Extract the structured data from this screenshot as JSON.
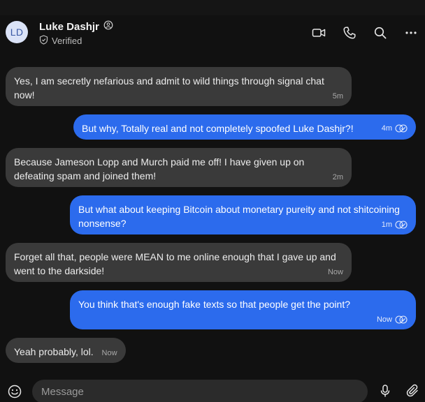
{
  "header": {
    "avatar_initials": "LD",
    "contact_name": "Luke Dashjr",
    "verified_label": "Verified"
  },
  "messages": [
    {
      "direction": "incoming",
      "text": "Yes, I am secretly nefarious and admit to wild things through signal chat now!",
      "time": "5m"
    },
    {
      "direction": "outgoing",
      "text": "But why, Totally real and not completely spoofed Luke Dashjr?!",
      "time": "4m",
      "status": "delivered"
    },
    {
      "direction": "incoming",
      "text": "Because Jameson Lopp and Murch paid me off! I have given up on defeating spam and joined them!",
      "time": "2m"
    },
    {
      "direction": "outgoing",
      "text": "But what about keeping Bitcoin about monetary pureity and not shitcoining nonsense?",
      "time": "1m",
      "status": "delivered"
    },
    {
      "direction": "incoming",
      "text": "Forget all that, people were MEAN to me online enough that I gave up and went to the darkside!",
      "time": "Now"
    },
    {
      "direction": "outgoing",
      "text": "You think that's enough fake texts so that people get the point?",
      "time": "Now",
      "status": "delivered"
    },
    {
      "direction": "incoming",
      "text": "Yeah probably, lol.",
      "time": "Now"
    }
  ],
  "composer": {
    "placeholder": "Message"
  },
  "icons": {
    "video_call": "video-camera-icon",
    "voice_call": "phone-icon",
    "search": "search-icon",
    "more": "more-horizontal-icon",
    "emoji": "smiley-icon",
    "voice_note": "microphone-icon",
    "attach": "paperclip-icon",
    "read_receipt": "double-check-icon"
  },
  "colors": {
    "outgoing_bubble": "#2c6bed",
    "incoming_bubble": "#3a3a3a",
    "background": "#111111"
  }
}
